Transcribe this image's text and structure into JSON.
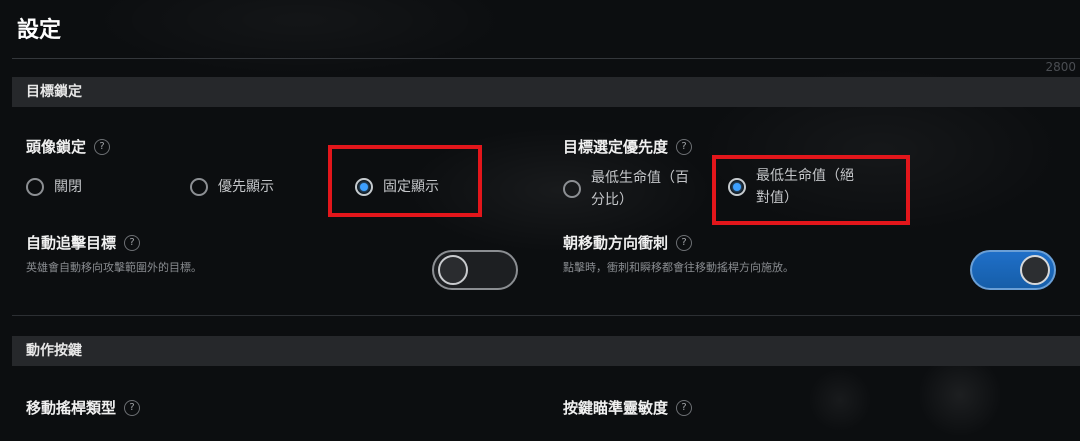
{
  "page": {
    "title": "設定",
    "corner_number": "2800"
  },
  "sections": {
    "target_lock": {
      "header": "目標鎖定",
      "avatar_lock": {
        "label": "頭像鎖定",
        "help_icon": "?",
        "options": [
          "關閉",
          "優先顯示",
          "固定顯示"
        ],
        "selected_index": 2
      },
      "target_priority": {
        "label": "目標選定優先度",
        "help_icon": "?",
        "options": [
          "最低生命值（百分比）",
          "最低生命值（絕對值）"
        ],
        "option_lines": [
          [
            "最低生命值（百",
            "分比）"
          ],
          [
            "最低生命值（絕",
            "對值）"
          ]
        ],
        "selected_index": 1
      },
      "auto_chase": {
        "label": "自動追擊目標",
        "help_icon": "?",
        "description": "英雄會自動移向攻擊範圍外的目標。",
        "enabled": false
      },
      "dash_direction": {
        "label": "朝移動方向衝刺",
        "help_icon": "?",
        "description": "點擊時，衝刺和瞬移都會往移動搖桿方向施放。",
        "enabled": true
      }
    },
    "action_buttons": {
      "header": "動作按鍵",
      "joystick_type": {
        "label": "移動搖桿類型",
        "help_icon": "?"
      },
      "aim_sensitivity": {
        "label": "按鍵瞄準靈敏度",
        "help_icon": "?"
      }
    }
  },
  "colors": {
    "background": "#0c0e10",
    "section_header_bg": "#26282b",
    "highlight_box": "#e3161b",
    "radio_selected": "#3da0ff",
    "toggle_on": "#1f6fc8"
  }
}
